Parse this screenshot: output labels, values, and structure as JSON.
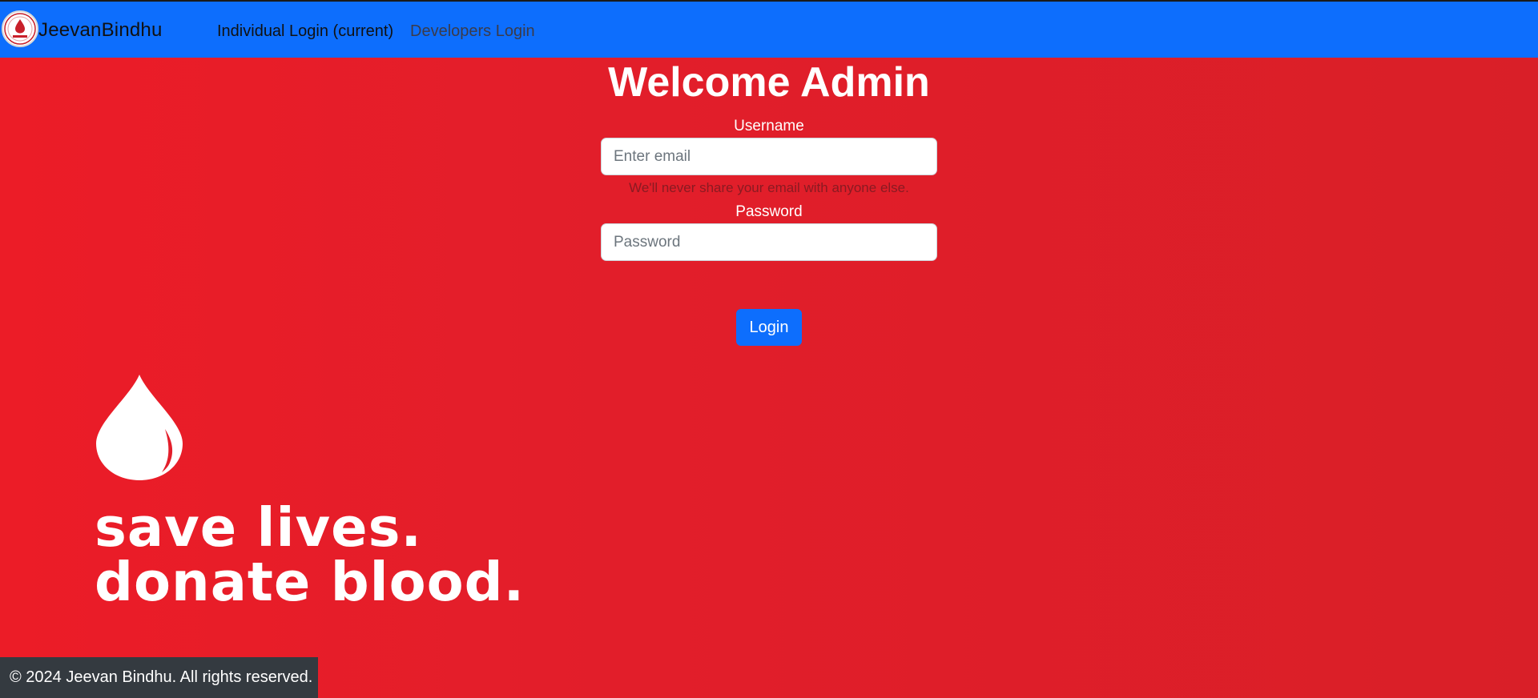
{
  "navbar": {
    "brand": "JeevanBindhu",
    "logo_icon": "blood-drop-logo-icon",
    "links": [
      {
        "label": "Individual Login (current)",
        "active": true
      },
      {
        "label": "Developers Login",
        "active": false
      }
    ],
    "background": "#0d6efd"
  },
  "login": {
    "title": "Welcome Admin",
    "username_label": "Username",
    "email_placeholder": "Enter email",
    "email_help": "We'll never share your email with anyone else.",
    "password_label": "Password",
    "password_placeholder": "Password",
    "submit_label": "Login"
  },
  "hero": {
    "icon": "blood-drop-icon",
    "line1": "save lives.",
    "line2": "donate blood."
  },
  "footer": {
    "text": "© 2024 Jeevan Bindhu. All rights reserved."
  },
  "colors": {
    "background_red": "#e31e2a",
    "primary_blue": "#0d6efd",
    "footer_dark": "#343a40"
  }
}
